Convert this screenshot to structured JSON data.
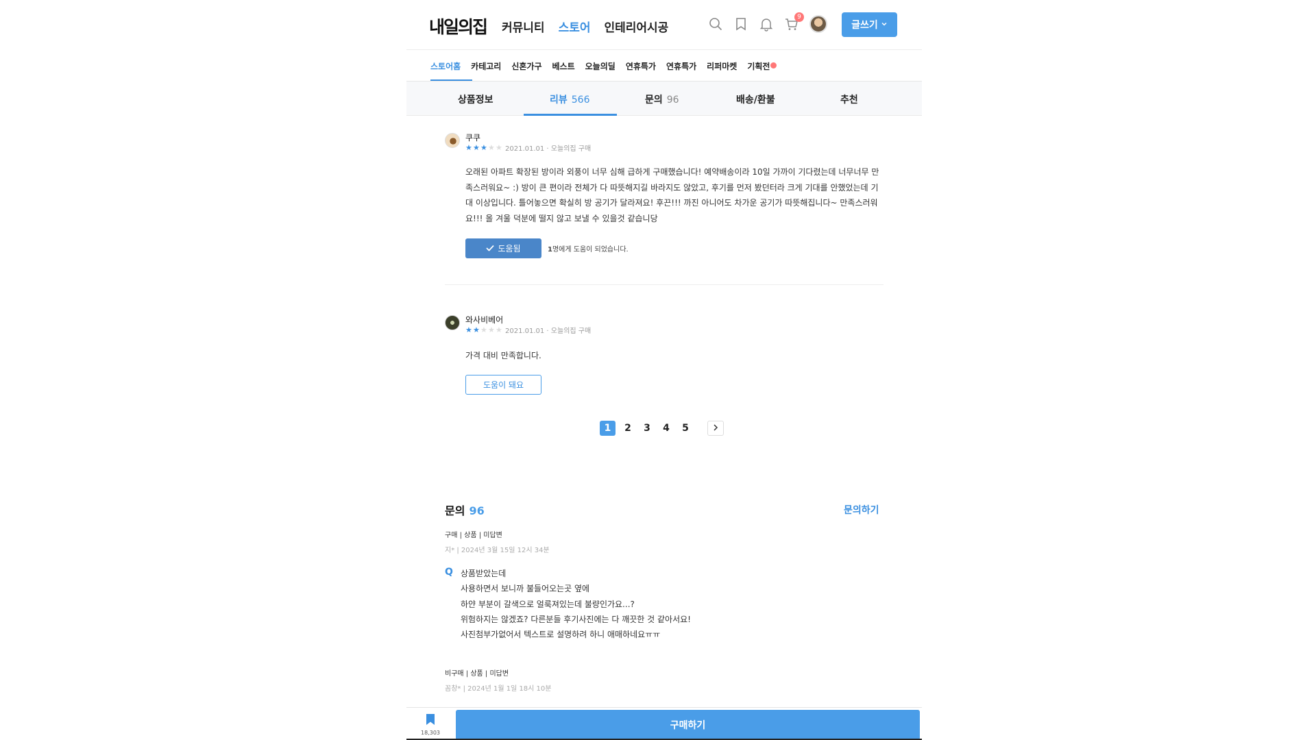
{
  "header": {
    "logo": "내일의집",
    "nav": [
      "커뮤니티",
      "스토어",
      "인테리어시공"
    ],
    "active_nav": "스토어",
    "cart_count": "9",
    "write_label": "글쓰기",
    "accent": "#4a9de8"
  },
  "subnav": {
    "items": [
      "스토어홈",
      "카테고리",
      "신혼가구",
      "베스트",
      "오늘의딜",
      "연휴특가",
      "연휴특가",
      "리퍼마켓",
      "기획전"
    ],
    "active": "스토어홈"
  },
  "product_tabs": [
    {
      "label": "상품정보",
      "count": ""
    },
    {
      "label": "리뷰",
      "count": "566"
    },
    {
      "label": "문의",
      "count": "96"
    },
    {
      "label": "배송/환불",
      "count": ""
    },
    {
      "label": "추천",
      "count": ""
    }
  ],
  "reviews": [
    {
      "name": "쿠쿠",
      "rating": 3,
      "meta": "2021.01.01 · 오늘의집 구매",
      "body": "오래된 아파트 확장된 방이라 외풍이 너무 심해 급하게 구매했습니다! 예약배송이라 10일 가까이 기다렸는데 너무너무 만족스러워요~ :) 방이 큰 편이라 전체가 다 따뜻해지길 바라지도 않았고, 후기를 먼저 봤던터라 크게 기대를 안했었는데 기대 이상입니다. 틀어놓으면 확실히 방 공기가 달라져요! 후끈!!! 까진 아니어도 차가운 공기가 따뜻해집니다~ 만족스러워요!!! 올 겨울 덕분에 떨지 않고 보낼 수 있을것 같습니당",
      "helpful_button": "도움됨",
      "helpful_count": "1",
      "helpful_suffix": "명에게 도움이 되었습니다."
    },
    {
      "name": "와사비베어",
      "rating": 2,
      "meta": "2021.01.01 · 오늘의집 구매",
      "body": "가격 대비 만족합니다.",
      "helpful_button": "도움이 돼요"
    }
  ],
  "pagination": {
    "pages": [
      "1",
      "2",
      "3",
      "4",
      "5"
    ],
    "active": "1"
  },
  "qa": {
    "title": "문의",
    "count": "96",
    "write_label": "문의하기",
    "items": [
      {
        "tags": "구매 | 상품 | 미답변",
        "author": "지* | 2024년 3월 15일 12시 34분",
        "q_mark": "Q",
        "lines": [
          "상품받았는데",
          "사용하면서 보니까 불들어오는곳 옆에",
          "하얀 부분이 갈색으로 얼룩져있는데 불량인가요...?",
          "위험하지는 않겠죠? 다른분들 후기사진에는 다 깨끗한 것 같아서요!",
          "사진첨부가없어서 텍스트로 설명하려 하니 애매하네요ㅠㅠ"
        ]
      },
      {
        "tags": "비구매 | 상품 | 미답변",
        "author": "꼼창* | 2024년 1월 1일 18시 10분"
      }
    ]
  },
  "bottom": {
    "bookmark_count": "18,303",
    "buy_label": "구매하기"
  }
}
